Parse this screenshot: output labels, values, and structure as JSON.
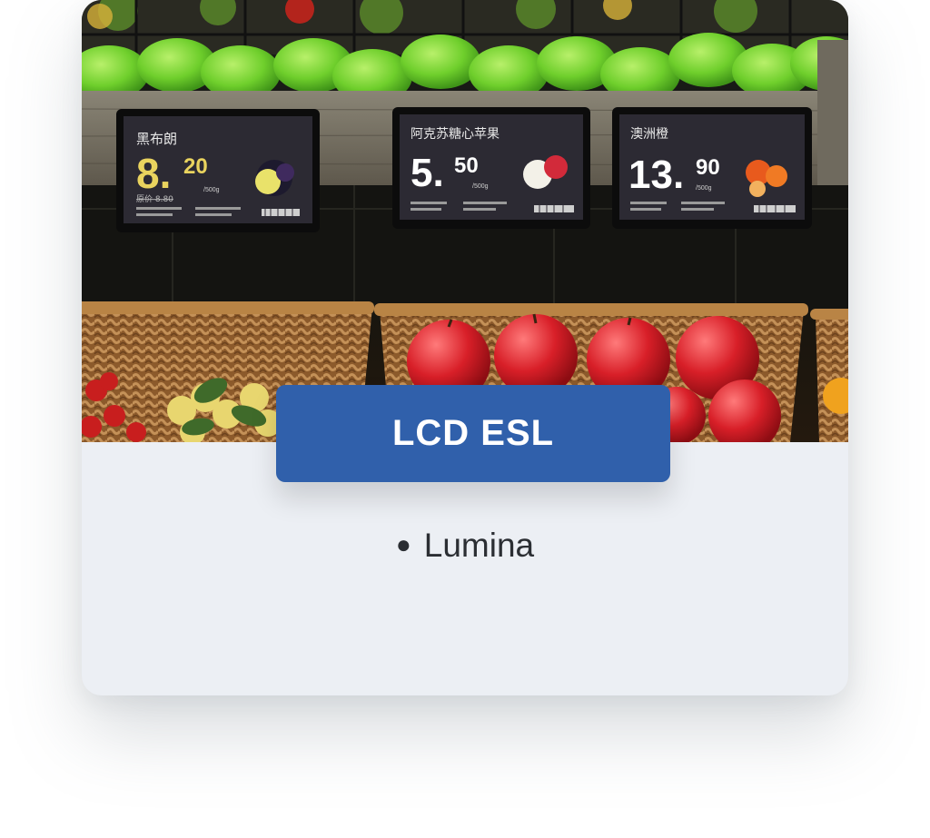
{
  "product_card": {
    "badge": "LCD ESL",
    "features": [
      "Lumina"
    ]
  },
  "shelf_labels": [
    {
      "name": "黑布朗",
      "price_main": "8.",
      "price_decimal": "20",
      "unit": "/500g",
      "was": "原价 8.80",
      "theme": "dark",
      "price_color": "#e9d35e"
    },
    {
      "name": "阿克苏糖心苹果",
      "price_main": "5.",
      "price_decimal": "50",
      "unit": "/500g",
      "theme": "dark",
      "price_color": "#ffffff"
    },
    {
      "name": "澳洲橙",
      "price_main": "13.",
      "price_decimal": "90",
      "unit": "/500g",
      "theme": "dark",
      "price_color": "#ffffff"
    }
  ],
  "colors": {
    "badge_bg": "#3060ab",
    "card_bg": "#eceff4",
    "text": "#2b2e33"
  }
}
